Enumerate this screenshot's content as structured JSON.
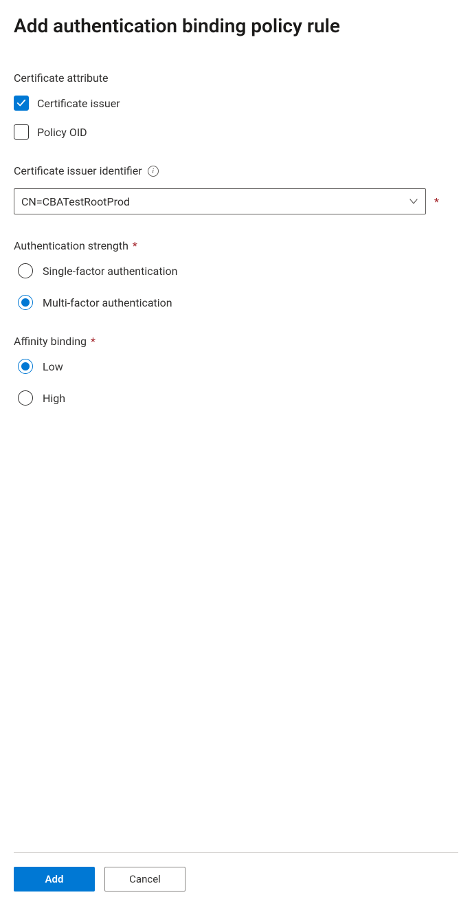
{
  "title": "Add authentication binding policy rule",
  "certificateAttribute": {
    "label": "Certificate attribute",
    "options": {
      "issuer": {
        "label": "Certificate issuer",
        "checked": true
      },
      "policyOid": {
        "label": "Policy OID",
        "checked": false
      }
    }
  },
  "issuerIdentifier": {
    "label": "Certificate issuer identifier",
    "value": "CN=CBATestRootProd",
    "required": true
  },
  "authStrength": {
    "label": "Authentication strength",
    "required": true,
    "options": {
      "single": {
        "label": "Single-factor authentication",
        "selected": false
      },
      "multi": {
        "label": "Multi-factor authentication",
        "selected": true
      }
    }
  },
  "affinityBinding": {
    "label": "Affinity binding",
    "required": true,
    "options": {
      "low": {
        "label": "Low",
        "selected": true
      },
      "high": {
        "label": "High",
        "selected": false
      }
    }
  },
  "buttons": {
    "add": "Add",
    "cancel": "Cancel"
  }
}
